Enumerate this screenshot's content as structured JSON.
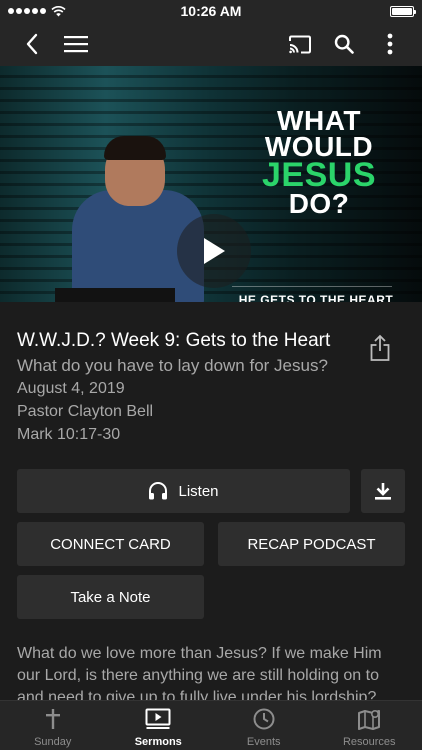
{
  "status_bar": {
    "time": "10:26 AM",
    "signal_icon": "signal-dots-icon",
    "wifi_icon": "wifi-icon",
    "battery_icon": "battery-icon"
  },
  "nav_bar": {
    "back_icon": "chevron-left-icon",
    "menu_icon": "hamburger-menu-icon",
    "cast_icon": "cast-icon",
    "search_icon": "search-icon",
    "more_icon": "more-vertical-icon"
  },
  "hero": {
    "title_lines": [
      "WHAT",
      "WOULD",
      "JESUS",
      "DO?"
    ],
    "subtitle": "HE GETS TO THE HEART",
    "play_icon": "play-icon",
    "accent_color": "#2bd46a"
  },
  "sermon": {
    "title": "W.W.J.D.? Week 9: Gets to the Heart",
    "subtitle": "What do you have to lay down for Jesus?",
    "date": "August 4, 2019",
    "speaker": "Pastor Clayton Bell",
    "scripture": "Mark 10:17-30",
    "share_icon": "share-icon"
  },
  "actions": {
    "listen_label": "Listen",
    "listen_icon": "headphones-icon",
    "download_icon": "download-icon",
    "connect_card_label": "CONNECT CARD",
    "recap_podcast_label": "RECAP PODCAST",
    "take_note_label": "Take a Note"
  },
  "description": "What do we love more than Jesus? If we make Him our Lord, is there anything we are still holding on to and need to give up to fully live under his lordship?",
  "tabs": [
    {
      "label": "Sunday",
      "icon": "cross-icon",
      "active": false
    },
    {
      "label": "Sermons",
      "icon": "video-play-icon",
      "active": true
    },
    {
      "label": "Events",
      "icon": "clock-icon",
      "active": false
    },
    {
      "label": "Resources",
      "icon": "map-icon",
      "active": false
    }
  ]
}
